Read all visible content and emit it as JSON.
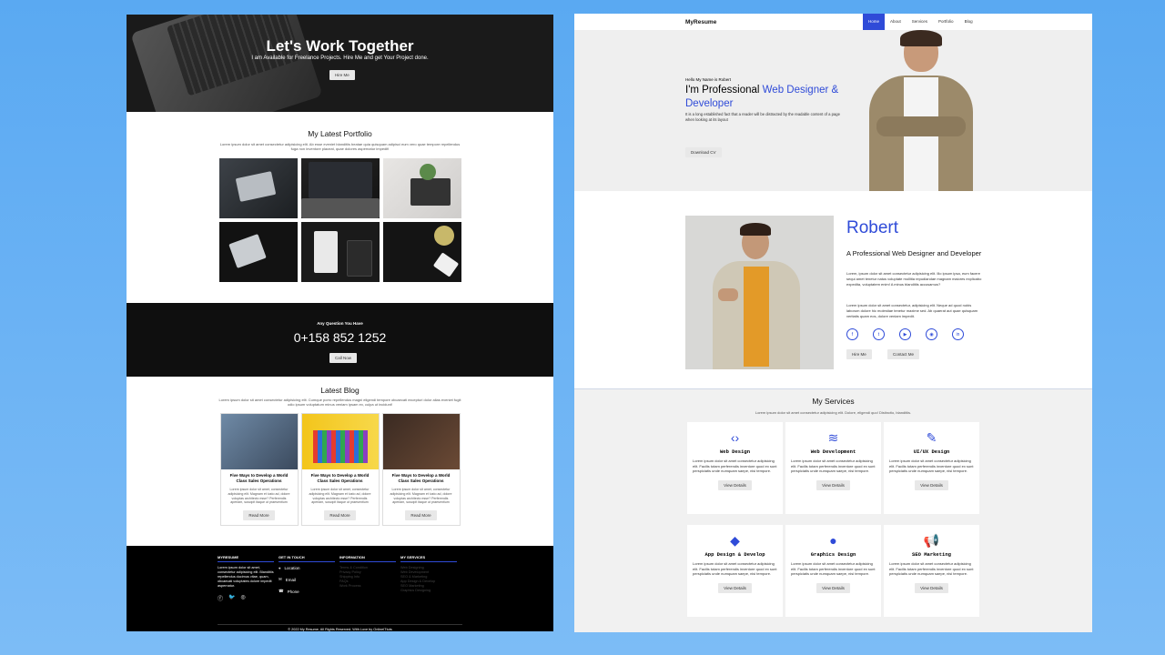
{
  "left": {
    "hero": {
      "title": "Let's Work Together",
      "subtitle": "I am Available for Freelance Projects. Hire Me and get Your Project done.",
      "button": "Hire Me"
    },
    "portfolio": {
      "title": "My Latest Portfolio",
      "text": "Lorem ipsum dolor sit amet consectetur adipisicing elit. Ab esse eveniet blanditiis beatae quia quisquam adipisci eum vero quae tempore repellendus fuga non inventore placeat, quae dolores aspernatur impedit!"
    },
    "cta": {
      "question": "Any Question You Have",
      "phone": "0+158 852 1252",
      "button": "Call Now"
    },
    "blog": {
      "title": "Latest Blog",
      "text": "Lorem ipsum dolor sit amet consectetur adipisicing elit. Cumque porro repellendus magni eligendi tempore obcaecati excepturi dolor alias eveniet fugit odio ipsum voluptatum minus veniam ipsam ex, culpa ut incidunt!",
      "cards": [
        {
          "title": "Five Ways to Develop a World Class Sales Operations",
          "text": "Lorem ipsum dolor sit amet, consectetur adipisicing elit. Magnam et iusto ad, dolore voluptas architecto esse? Perferendis aperiam, suscipit itaque ut praesentium",
          "button": "Read More"
        },
        {
          "title": "Five Ways to Develop a World Class Sales Operations",
          "text": "Lorem ipsum dolor sit amet, consectetur adipisicing elit. Magnam et iusto ad, dolore voluptas architecto esse? Perferendis aperiam, suscipit itaque ut praesentium",
          "button": "Read More"
        },
        {
          "title": "Five Ways to Develop a World Class Sales Operations",
          "text": "Lorem ipsum dolor sit amet, consectetur adipisicing elit. Magnam et iusto ad, dolore voluptas architecto esse? Perferendis aperiam, suscipit itaque ut praesentium",
          "button": "Read More"
        }
      ]
    },
    "footer": {
      "about_title": "MYRESUME",
      "about_text": "Lorem ipsum dolor sit amet, consectetur adipisicing elit. Blanditiis repellendus ducimus vitae, quam, obcaecati voluptates dolore impedit aspernatur.",
      "contact_title": "GET IN TOUCH",
      "contact": [
        "Location",
        "Email",
        "Phone"
      ],
      "info_title": "INFORMATION",
      "info": [
        "Terms & Condition",
        "Privacy Policy",
        "Shipping Info",
        "FAQs",
        "Work Process"
      ],
      "services_title": "MY SERVICES",
      "services": [
        "Web Designing",
        "Web Development",
        "SEO & Marketing",
        "App Design & Develop",
        "SEO Marketing",
        "Graphics Designing"
      ],
      "copyright": "© 2022 My Resume, All Rights Reserved. With Love by OnlineITtuts"
    }
  },
  "right": {
    "nav": {
      "brand": "MyResume",
      "items": [
        "Home",
        "About",
        "Services",
        "Portfolio",
        "Blog"
      ]
    },
    "hero": {
      "hello": "Hello My Name is Robert",
      "title_a": "I'm Professional ",
      "title_b": "Web Designer & Developer",
      "desc": "It is a long established fact that a reader will be distracted by the readable content of a page when looking at its layout",
      "button": "Download CV"
    },
    "about": {
      "name": "Robert",
      "role": "A Professional Web Designer and Developer",
      "p1": "Lorem, ipsum dolor sit amet consectetur adipisicing elit. Illo ipsum ipsa, eum facere sequi amet tenetur natus voluptate mollitia repudiandae magnam maiores explicabo expedita, voluptatem enim! A minus blanditiis accusamus?",
      "p2": "Lorem ipsum dolor sit amet consectetur, adipisicing elit. Neque ad quod nobis laborum dolore hic molestiae tenetur maxime sed. Ab quaerat aut quae quisquam veritatis quam eos, dolore veniam impedit.",
      "hire": "Hire Me",
      "contact": "Contact Me"
    },
    "services": {
      "title": "My Services",
      "text": "Lorem ipsum dolor sit amet consectetur adipisicing elit. Dolore, eligendi quo! Distinctio, blanditiis.",
      "cards": [
        {
          "icon": "code-icon",
          "glyph": "‹›",
          "title": "Web Design",
          "text": "Lorem ipsum dolor sit amet consectetur adipisicing elit. Facilis totam perferendis inventore quod ex sunt perspiciatis unde numquam saepe, nisi tempore.",
          "button": "View Details"
        },
        {
          "icon": "layers-icon",
          "glyph": "≋",
          "title": "Web Development",
          "text": "Lorem ipsum dolor sit amet consectetur adipisicing elit. Facilis totam perferendis inventore quod ex sunt perspiciatis unde numquam saepe, nisi tempore.",
          "button": "View Details"
        },
        {
          "icon": "pen-icon",
          "glyph": "✎",
          "title": "UI/UX Design",
          "text": "Lorem ipsum dolor sit amet consectetur adipisicing elit. Facilis totam perferendis inventore quod ex sunt perspiciatis unde numquam saepe, nisi tempore.",
          "button": "View Details"
        },
        {
          "icon": "diamond-icon",
          "glyph": "◆",
          "title": "App Design & Develop",
          "text": "Lorem ipsum dolor sit amet consectetur adipisicing elit. Facilis totam perferendis inventore quod ex sunt perspiciatis unde numquam saepe, nisi tempore.",
          "button": "View Details"
        },
        {
          "icon": "palette-icon",
          "glyph": "●",
          "title": "Graphics Design",
          "text": "Lorem ipsum dolor sit amet consectetur adipisicing elit. Facilis totam perferendis inventore quod ex sunt perspiciatis unde numquam saepe, nisi tempore.",
          "button": "View Details"
        },
        {
          "icon": "megaphone-icon",
          "glyph": "📢",
          "title": "SEO Marketing",
          "text": "Lorem ipsum dolor sit amet consectetur adipisicing elit. Facilis totam perferendis inventore quod ex sunt perspiciatis unde numquam saepe, nisi tempore.",
          "button": "View Details"
        }
      ]
    }
  },
  "colors": {
    "accent": "#2f4bd8",
    "dark": "#0f0f0f",
    "background": "#6bb3f4"
  }
}
